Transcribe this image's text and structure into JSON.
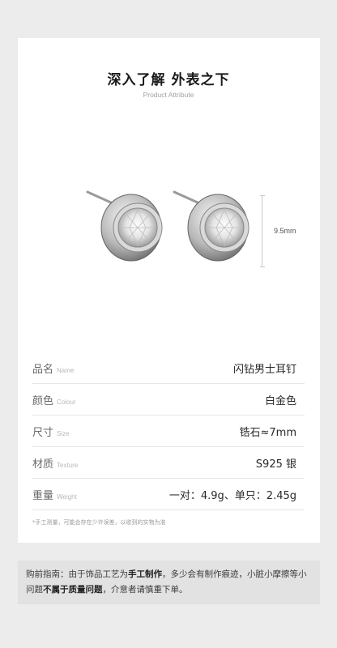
{
  "header": {
    "title": "深入了解 外表之下",
    "subtitle": "Product Attribute"
  },
  "dimension": {
    "label": "9.5mm"
  },
  "specs": [
    {
      "label": "品名",
      "label_en": "Name",
      "value": "闪钻男士耳钉"
    },
    {
      "label": "颜色",
      "label_en": "Colour",
      "value": "白金色"
    },
    {
      "label": "尺寸",
      "label_en": "Size",
      "value": "锆石≈7mm"
    },
    {
      "label": "材质",
      "label_en": "Texture",
      "value": "S925 银"
    },
    {
      "label": "重量",
      "label_en": "Weight",
      "value": "一对：4.9g、单只：2.45g"
    }
  ],
  "note": "*手工测量，可能会存在少许误差，以收到的实物为准",
  "notice": {
    "part1": "购前指南：由于饰品工艺为",
    "bold1": "手工制作",
    "part2": "，多少会有制作痕迹，小脏小摩擦等小问题",
    "bold2": "不属于质量问题",
    "part3": "，介意者请慎重下单。"
  },
  "colors": {
    "background": "#ececec",
    "card": "#ffffff",
    "notice_bg": "#e2e2e2"
  }
}
